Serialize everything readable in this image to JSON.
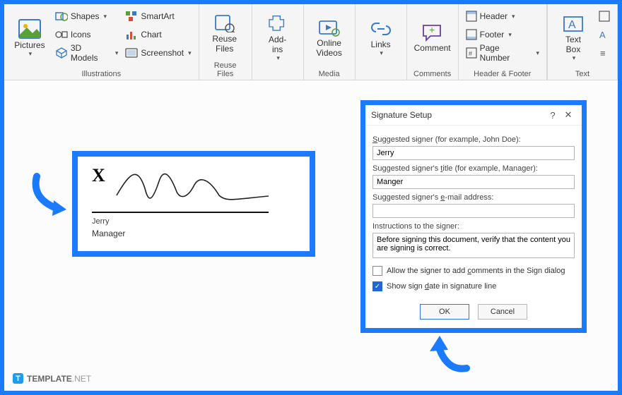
{
  "ribbon": {
    "groups": {
      "illustrations": {
        "label": "Illustrations",
        "pictures": "Pictures",
        "shapes": "Shapes",
        "icons": "Icons",
        "models3d": "3D Models",
        "smartart": "SmartArt",
        "chart": "Chart",
        "screenshot": "Screenshot"
      },
      "reuse": {
        "label": "Reuse Files",
        "btn": "Reuse\nFiles"
      },
      "addins": {
        "btn": "Add-\nins"
      },
      "media": {
        "label": "Media",
        "btn": "Online\nVideos"
      },
      "links": {
        "btn": "Links"
      },
      "comments": {
        "label": "Comments",
        "btn": "Comment"
      },
      "header_footer": {
        "label": "Header & Footer",
        "header": "Header",
        "footer": "Footer",
        "page_number": "Page Number"
      },
      "text": {
        "label": "Text",
        "textbox": "Text\nBox"
      }
    }
  },
  "signature": {
    "name": "Jerry",
    "title": "Manager",
    "x": "X"
  },
  "dialog": {
    "title": "Signature Setup",
    "signer_label": "Suggested signer (for example, John Doe):",
    "signer_value": "Jerry",
    "title_label": "Suggested signer's title (for example, Manager):",
    "title_value": "Manger",
    "email_label": "Suggested signer's e-mail address:",
    "email_value": "",
    "instructions_label": "Instructions to the signer:",
    "instructions_value": "Before signing this document, verify that the content you are signing is correct.",
    "chk_comments": "Allow the signer to add comments in the Sign dialog",
    "chk_date": "Show sign date in signature line",
    "ok": "OK",
    "cancel": "Cancel"
  },
  "brand": {
    "name": "TEMPLATE",
    "suffix": ".NET"
  }
}
